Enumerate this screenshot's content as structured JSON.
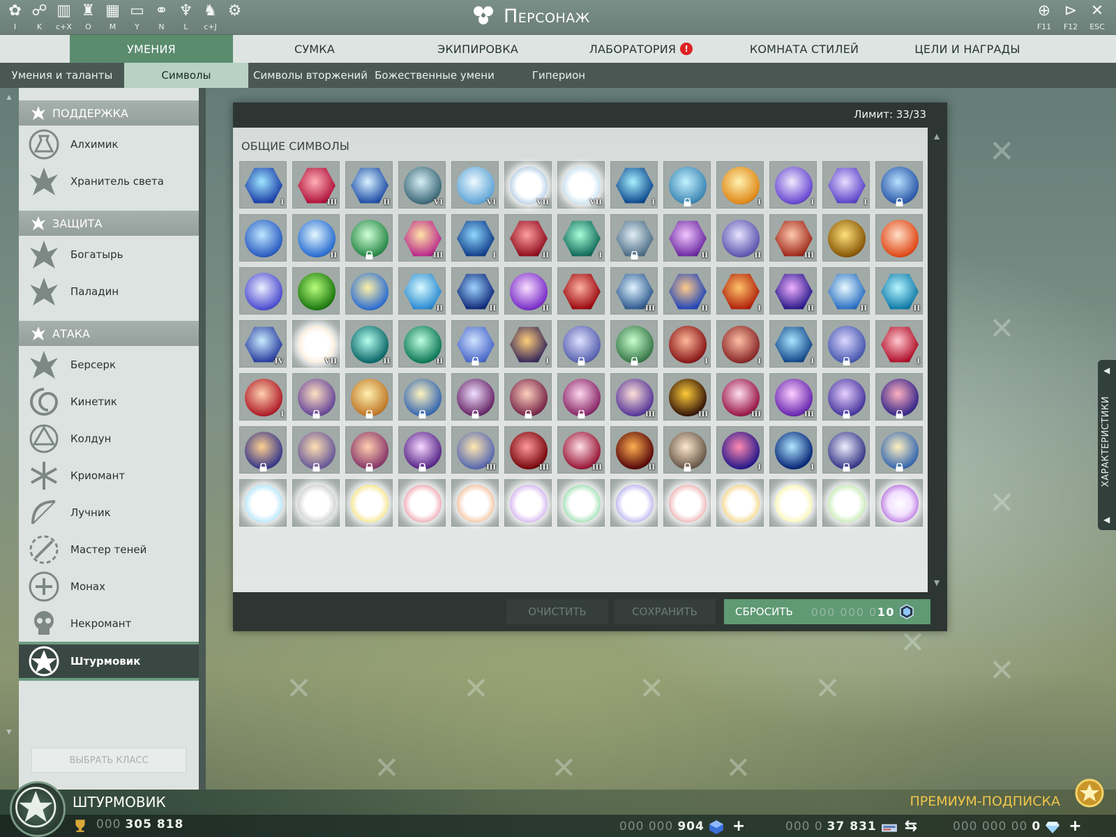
{
  "window": {
    "title": "Персонаж"
  },
  "top_icons": [
    {
      "icon": "character-icon",
      "key": "I"
    },
    {
      "icon": "skills-tree-icon",
      "key": "K"
    },
    {
      "icon": "stats-icon",
      "key": "c+X"
    },
    {
      "icon": "guild-icon",
      "key": "O"
    },
    {
      "icon": "map-icon",
      "key": "M"
    },
    {
      "icon": "chat-icon",
      "key": "Y"
    },
    {
      "icon": "handshake-icon",
      "key": "N"
    },
    {
      "icon": "league-icon",
      "key": "L"
    },
    {
      "icon": "mount-icon",
      "key": "c+J"
    },
    {
      "icon": "settings-icon",
      "key": ""
    }
  ],
  "right_icons": [
    {
      "icon": "network-icon",
      "key": "F11"
    },
    {
      "icon": "exit-door-icon",
      "key": "F12"
    },
    {
      "icon": "close-icon",
      "key": "ESC"
    }
  ],
  "main_tabs": [
    {
      "label": "Умения",
      "active": true,
      "alert": false
    },
    {
      "label": "Сумка",
      "active": false,
      "alert": false
    },
    {
      "label": "Экипировка",
      "active": false,
      "alert": false
    },
    {
      "label": "Лаборатория",
      "active": false,
      "alert": true,
      "alert_text": "!"
    },
    {
      "label": "Комната стилей",
      "active": false,
      "alert": false
    },
    {
      "label": "Цели и награды",
      "active": false,
      "alert": false
    }
  ],
  "sub_tabs": [
    {
      "label": "Умения и таланты",
      "active": false
    },
    {
      "label": "Символы",
      "active": true
    },
    {
      "label": "Символы вторжений",
      "active": false
    },
    {
      "label": "Божественные умени",
      "active": false
    },
    {
      "label": "Гиперион",
      "active": false
    }
  ],
  "sidebar": {
    "groups": [
      {
        "label": "Поддержка",
        "icon": "ankh-icon",
        "classes": [
          {
            "label": "Алхимик",
            "icon": "flask-icon"
          },
          {
            "label": "Хранитель света",
            "icon": "light-wings-icon"
          }
        ]
      },
      {
        "label": "Защита",
        "icon": "shield-icon",
        "classes": [
          {
            "label": "Богатырь",
            "icon": "eagle-icon"
          },
          {
            "label": "Паладин",
            "icon": "sword-wings-icon"
          }
        ]
      },
      {
        "label": "Атака",
        "icon": "dagger-icon",
        "classes": [
          {
            "label": "Берсерк",
            "icon": "berserk-helmet-icon"
          },
          {
            "label": "Кинетик",
            "icon": "spiral-icon"
          },
          {
            "label": "Колдун",
            "icon": "rune-circle-icon"
          },
          {
            "label": "Криомант",
            "icon": "snowflake-icon"
          },
          {
            "label": "Лучник",
            "icon": "bow-icon"
          },
          {
            "label": "Мастер теней",
            "icon": "shadow-blades-icon"
          },
          {
            "label": "Монах",
            "icon": "monk-seal-icon"
          },
          {
            "label": "Некромант",
            "icon": "skull-icon"
          },
          {
            "label": "Штурмовик",
            "icon": "star-badge-icon",
            "active": true
          }
        ]
      }
    ],
    "choose_button": "Выбрать класс"
  },
  "panel": {
    "limit_text": "Лимит: 33/33",
    "grid_title": "Общие символы",
    "buttons": {
      "clear": "Очистить",
      "save": "Сохранить",
      "reset": "Сбросить"
    },
    "reset_cost": {
      "zeros": "000 000 0",
      "value": "10",
      "icon": "crystal-icon"
    },
    "colors": {
      "panel": "#2e3634",
      "reset": "#5f9a74"
    }
  },
  "symbols": [
    {
      "name": "sprint-arrows-icon",
      "rank": "I",
      "locked": false,
      "c1": "#9fe6ff",
      "c2": "#1b3fa8",
      "hex": true
    },
    {
      "name": "red-claw-icon",
      "rank": "III",
      "locked": false,
      "c1": "#ffb0b8",
      "c2": "#b0123a",
      "hex": true
    },
    {
      "name": "crystal-cross-icon",
      "rank": "II",
      "locked": false,
      "c1": "#d9f3ff",
      "c2": "#1f4fa8",
      "hex": true
    },
    {
      "name": "target-ring-icon",
      "rank": "VI",
      "locked": false,
      "c1": "#d8f0f6",
      "c2": "#3f6b7a",
      "hex": false
    },
    {
      "name": "ice-cube-icon",
      "rank": "VI",
      "locked": false,
      "c1": "#eefaff",
      "c2": "#63a7d8",
      "hex": false
    },
    {
      "name": "white-prism-icon",
      "rank": "VII",
      "locked": false,
      "c1": "#ffffff",
      "c2": "#8fb4da",
      "hex": false,
      "faint": true
    },
    {
      "name": "white-shard-icon",
      "rank": "VII",
      "locked": false,
      "c1": "#ffffff",
      "c2": "#a8d2ea",
      "hex": false,
      "faint": true
    },
    {
      "name": "blue-fist-icon",
      "rank": "I",
      "locked": false,
      "c1": "#a7f0ff",
      "c2": "#0e4a8f",
      "hex": true
    },
    {
      "name": "winged-shield-icon",
      "rank": "",
      "locked": true,
      "c1": "#c3f2ff",
      "c2": "#3f88b5",
      "hex": false
    },
    {
      "name": "golden-flare-icon",
      "rank": "I",
      "locked": false,
      "c1": "#fff2b2",
      "c2": "#e08a1a",
      "hex": false
    },
    {
      "name": "lightning-spiral-icon",
      "rank": "I",
      "locked": false,
      "c1": "#f1eaff",
      "c2": "#6a49d1",
      "hex": false
    },
    {
      "name": "lightning-bolt-icon",
      "rank": "I",
      "locked": false,
      "c1": "#eadcff",
      "c2": "#5b45c9",
      "hex": true
    },
    {
      "name": "blue-guardian-icon",
      "rank": "",
      "locked": true,
      "c1": "#b7e0ff",
      "c2": "#2e5aa8",
      "hex": false
    },
    {
      "name": "blue-figure-icon",
      "rank": "",
      "locked": false,
      "c1": "#bfe7ff",
      "c2": "#2c5ec2",
      "hex": false
    },
    {
      "name": "blue-vortex-icon",
      "rank": "II",
      "locked": false,
      "c1": "#e7f8ff",
      "c2": "#2a6fd1",
      "hex": false
    },
    {
      "name": "green-antlers-icon",
      "rank": "",
      "locked": true,
      "c1": "#d1ffd8",
      "c2": "#2b8a4a",
      "hex": false
    },
    {
      "name": "fire-fist-icon",
      "rank": "III",
      "locked": false,
      "c1": "#ffe4a6",
      "c2": "#b82b8a",
      "hex": true
    },
    {
      "name": "blue-runner-icon",
      "rank": "I",
      "locked": false,
      "c1": "#8fd8ff",
      "c2": "#123f8a",
      "hex": true
    },
    {
      "name": "red-runner-icon",
      "rank": "II",
      "locked": false,
      "c1": "#ff9fa0",
      "c2": "#8f1020",
      "hex": true
    },
    {
      "name": "green-runner-icon",
      "rank": "I",
      "locked": false,
      "c1": "#a8ffd9",
      "c2": "#126a5a",
      "hex": true
    },
    {
      "name": "steel-swirl-icon",
      "rank": "",
      "locked": true,
      "c1": "#e1eef6",
      "c2": "#4e6e86",
      "hex": true
    },
    {
      "name": "purple-dancer-icon",
      "rank": "II",
      "locked": false,
      "c1": "#f1c8ff",
      "c2": "#6d2aa1",
      "hex": true
    },
    {
      "name": "armored-titan-icon",
      "rank": "II",
      "locked": false,
      "c1": "#e8e4ff",
      "c2": "#5f57b0",
      "hex": false
    },
    {
      "name": "red-skull-icon",
      "rank": "III",
      "locked": false,
      "c1": "#ffc9b0",
      "c2": "#9f2a1a",
      "hex": true
    },
    {
      "name": "gold-fist-icon",
      "rank": "",
      "locked": false,
      "c1": "#ffe17a",
      "c2": "#8a5a0a",
      "hex": false
    },
    {
      "name": "ember-figure-icon",
      "rank": "",
      "locked": false,
      "c1": "#ffe1c9",
      "c2": "#e04a1a",
      "hex": false
    },
    {
      "name": "purple-spirit-icon",
      "rank": "",
      "locked": false,
      "c1": "#eef0ff",
      "c2": "#4f4fd1",
      "hex": false
    },
    {
      "name": "green-fist-icon",
      "rank": "",
      "locked": false,
      "c1": "#b7ff7d",
      "c2": "#1f7a10",
      "hex": false
    },
    {
      "name": "sun-dragon-icon",
      "rank": "",
      "locked": false,
      "c1": "#fff1a6",
      "c2": "#2f6fd1",
      "hex": false
    },
    {
      "name": "ice-arrow-icon",
      "rank": "II",
      "locked": false,
      "c1": "#d9fbff",
      "c2": "#2a8ad1",
      "hex": true
    },
    {
      "name": "blue-boot-icon",
      "rank": "II",
      "locked": false,
      "c1": "#9fd3ff",
      "c2": "#102a7a",
      "hex": true
    },
    {
      "name": "violet-aura-icon",
      "rank": "II",
      "locked": false,
      "c1": "#fbe0ff",
      "c2": "#7a30c9",
      "hex": false
    },
    {
      "name": "red-burst-icon",
      "rank": "",
      "locked": false,
      "c1": "#ffb0a0",
      "c2": "#9a0a10",
      "hex": true
    },
    {
      "name": "ghost-skull-icon",
      "rank": "III",
      "locked": false,
      "c1": "#dff4ff",
      "c2": "#2f5a8f",
      "hex": true
    },
    {
      "name": "fire-comet-icon",
      "rank": "II",
      "locked": false,
      "c1": "#ffca8a",
      "c2": "#2346b8",
      "hex": true
    },
    {
      "name": "lava-wave-icon",
      "rank": "I",
      "locked": false,
      "c1": "#ffc46a",
      "c2": "#b0220a",
      "hex": true
    },
    {
      "name": "meditation-icon",
      "rank": "II",
      "locked": false,
      "c1": "#f0b0ff",
      "c2": "#2a1a8a",
      "hex": true
    },
    {
      "name": "ice-beam-icon",
      "rank": "II",
      "locked": false,
      "c1": "#e9fbff",
      "c2": "#2b6fc2",
      "hex": true
    },
    {
      "name": "ice-shards-icon",
      "rank": "II",
      "locked": false,
      "c1": "#b7f6ff",
      "c2": "#0f7aa8",
      "hex": true
    },
    {
      "name": "frost-armor-icon",
      "rank": "IV",
      "locked": false,
      "c1": "#c9ecff",
      "c2": "#2b3f9f",
      "hex": true
    },
    {
      "name": "white-nova-icon",
      "rank": "VII",
      "locked": false,
      "c1": "#ffffff",
      "c2": "#f4dfbf",
      "hex": false,
      "faint": true
    },
    {
      "name": "teal-spire-icon",
      "rank": "II",
      "locked": false,
      "c1": "#b5fff0",
      "c2": "#0f6a6a",
      "hex": false
    },
    {
      "name": "green-crown-icon",
      "rank": "II",
      "locked": false,
      "c1": "#c0ffe0",
      "c2": "#0f7a5a",
      "hex": false
    },
    {
      "name": "storm-hex-icon",
      "rank": "",
      "locked": true,
      "c1": "#cfe3ff",
      "c2": "#4a68c9",
      "hex": true
    },
    {
      "name": "honeycomb-icon",
      "rank": "I",
      "locked": false,
      "c1": "#ffcf7a",
      "c2": "#3a2a5a",
      "hex": true
    },
    {
      "name": "moon-arc-icon",
      "rank": "",
      "locked": true,
      "c1": "#dfe2ff",
      "c2": "#5a63b0",
      "hex": false
    },
    {
      "name": "leaping-warrior-icon",
      "rank": "",
      "locked": true,
      "c1": "#c8ffd0",
      "c2": "#3a7a4a",
      "hex": false
    },
    {
      "name": "blood-blade-icon",
      "rank": "I",
      "locked": false,
      "c1": "#ffb89a",
      "c2": "#8a1a1a",
      "hex": false
    },
    {
      "name": "winged-demon-icon",
      "rank": "I",
      "locked": false,
      "c1": "#ffc0a6",
      "c2": "#8a2a2a",
      "hex": false
    },
    {
      "name": "blue-sentinel-icon",
      "rank": "I",
      "locked": false,
      "c1": "#a9e5ff",
      "c2": "#14498a",
      "hex": true
    },
    {
      "name": "void-orb-icon",
      "rank": "",
      "locked": true,
      "c1": "#dcd8ff",
      "c2": "#4a5ab0",
      "hex": false
    },
    {
      "name": "crimson-core-icon",
      "rank": "I",
      "locked": false,
      "c1": "#ffc8d0",
      "c2": "#b0102a",
      "hex": true
    },
    {
      "name": "flame-crest-icon",
      "rank": "I",
      "locked": false,
      "c1": "#ffd0b0",
      "c2": "#b0202a",
      "hex": false
    },
    {
      "name": "golden-hero-icon",
      "rank": "",
      "locked": true,
      "c1": "#ffe0c0",
      "c2": "#6a4a9a",
      "hex": false
    },
    {
      "name": "sun-warrior-icon",
      "rank": "",
      "locked": true,
      "c1": "#fff0b0",
      "c2": "#c07a2a",
      "hex": false
    },
    {
      "name": "phoenix-wings-icon",
      "rank": "",
      "locked": true,
      "c1": "#fff3c0",
      "c2": "#3a6ab0",
      "hex": false
    },
    {
      "name": "dark-knight-icon",
      "rank": "",
      "locked": true,
      "c1": "#f0e0ff",
      "c2": "#6a2a6a",
      "hex": false
    },
    {
      "name": "crimson-burst-icon",
      "rank": "",
      "locked": true,
      "c1": "#ffd0c0",
      "c2": "#7a2a4a",
      "hex": false
    },
    {
      "name": "pink-spiral-icon",
      "rank": "",
      "locked": true,
      "c1": "#ffd8f0",
      "c2": "#8a2a6a",
      "hex": false
    },
    {
      "name": "plasma-flash-icon",
      "rank": "III",
      "locked": false,
      "c1": "#ffe0d8",
      "c2": "#5a3a9a",
      "hex": false
    },
    {
      "name": "golden-storm-icon",
      "rank": "III",
      "locked": false,
      "c1": "#ffcc3a",
      "c2": "#3a1a0a",
      "hex": false
    },
    {
      "name": "radiant-burst-icon",
      "rank": "III",
      "locked": false,
      "c1": "#ffe0f0",
      "c2": "#9a1a4a",
      "hex": false
    },
    {
      "name": "magenta-slash-icon",
      "rank": "III",
      "locked": false,
      "c1": "#ffd0ff",
      "c2": "#6a2ab0",
      "hex": false
    },
    {
      "name": "violet-wave-icon",
      "rank": "",
      "locked": true,
      "c1": "#e8d0ff",
      "c2": "#4a3aa0",
      "hex": false
    },
    {
      "name": "claw-strike-icon",
      "rank": "",
      "locked": true,
      "c1": "#ffb0c0",
      "c2": "#3a2a8a",
      "hex": false
    },
    {
      "name": "fire-vortex-icon",
      "rank": "",
      "locked": true,
      "c1": "#ffd090",
      "c2": "#3a3a8a",
      "hex": false
    },
    {
      "name": "eagle-guardian-icon",
      "rank": "",
      "locked": true,
      "c1": "#ffe0b0",
      "c2": "#6a5a9a",
      "hex": false
    },
    {
      "name": "light-pillar-icon",
      "rank": "",
      "locked": true,
      "c1": "#ffd0b0",
      "c2": "#8a3a6a",
      "hex": false
    },
    {
      "name": "violet-caster-icon",
      "rank": "",
      "locked": true,
      "c1": "#f8d8ff",
      "c2": "#5a2a8a",
      "hex": false
    },
    {
      "name": "lightning-dash-icon",
      "rank": "III",
      "locked": false,
      "c1": "#ffe8b0",
      "c2": "#5a6ab0",
      "hex": false
    },
    {
      "name": "zombie-head-icon",
      "rank": "III",
      "locked": false,
      "c1": "#ff9a9a",
      "c2": "#7a0a10",
      "hex": false
    },
    {
      "name": "rose-flare-icon",
      "rank": "III",
      "locked": false,
      "c1": "#ffe0e8",
      "c2": "#9a1a3a",
      "hex": false
    },
    {
      "name": "fire-trio-icon",
      "rank": "II",
      "locked": false,
      "c1": "#ffb050",
      "c2": "#5a0a0a",
      "hex": false
    },
    {
      "name": "monk-master-icon",
      "rank": "",
      "locked": true,
      "c1": "#ffe8d0",
      "c2": "#6a5a4a",
      "hex": false
    },
    {
      "name": "red-avatar-icon",
      "rank": "I",
      "locked": false,
      "c1": "#ff8ab0",
      "c2": "#2a1a8a",
      "hex": false
    },
    {
      "name": "blue-eclipse-icon",
      "rank": "I",
      "locked": false,
      "c1": "#b0e8ff",
      "c2": "#0a2a7a",
      "hex": false
    },
    {
      "name": "star-flash-icon",
      "rank": "",
      "locked": true,
      "c1": "#f0f0ff",
      "c2": "#3a3a8a",
      "hex": false
    },
    {
      "name": "ancient-scroll-icon",
      "rank": "",
      "locked": true,
      "c1": "#fff0c0",
      "c2": "#3a6ab0",
      "hex": false
    },
    {
      "name": "snowflake-symbol-icon",
      "rank": "",
      "locked": false,
      "c1": "#ffffff",
      "c2": "#8ad8ff",
      "hex": false,
      "faint": true
    },
    {
      "name": "winged-sword-icon",
      "rank": "",
      "locked": false,
      "c1": "#ffffff",
      "c2": "#b8b8b8",
      "hex": false,
      "faint": true
    },
    {
      "name": "golden-wings-icon",
      "rank": "",
      "locked": false,
      "c1": "#ffffff",
      "c2": "#f2d84a",
      "hex": false,
      "faint": true
    },
    {
      "name": "heart-wings-icon",
      "rank": "",
      "locked": false,
      "c1": "#ffffff",
      "c2": "#e87a8a",
      "hex": false,
      "faint": true
    },
    {
      "name": "flame-crown-icon",
      "rank": "",
      "locked": false,
      "c1": "#ffffff",
      "c2": "#f0a36a",
      "hex": false,
      "faint": true
    },
    {
      "name": "violet-ring-icon",
      "rank": "",
      "locked": false,
      "c1": "#ffffff",
      "c2": "#c08ae8",
      "hex": false,
      "faint": true
    },
    {
      "name": "green-skull-icon",
      "rank": "",
      "locked": false,
      "c1": "#ffffff",
      "c2": "#6ad08a",
      "hex": false,
      "faint": true
    },
    {
      "name": "purple-swirl-icon",
      "rank": "",
      "locked": false,
      "c1": "#ffffff",
      "c2": "#9a8ae8",
      "hex": false,
      "faint": true
    },
    {
      "name": "crimson-ring-icon",
      "rank": "",
      "locked": false,
      "c1": "#ffffff",
      "c2": "#e88a8a",
      "hex": false,
      "faint": true
    },
    {
      "name": "golden-phoenix-icon",
      "rank": "",
      "locked": false,
      "c1": "#ffffff",
      "c2": "#f2c24a",
      "hex": false,
      "faint": true
    },
    {
      "name": "sun-disc-icon",
      "rank": "",
      "locked": false,
      "c1": "#ffffff",
      "c2": "#f5f08a",
      "hex": false,
      "faint": true
    },
    {
      "name": "green-pyramid-icon",
      "rank": "",
      "locked": false,
      "c1": "#ffffff",
      "c2": "#a8e08a",
      "hex": false,
      "faint": true
    },
    {
      "name": "violet-triangle-icon",
      "rank": "",
      "locked": false,
      "c1": "#f2e0ff",
      "c2": "#a04ad0",
      "hex": false,
      "faint": true
    }
  ],
  "side_tab": {
    "label": "Характеристики"
  },
  "bottom": {
    "class_name": "Штурмовик",
    "premium": "Премиум-подписка",
    "currencies": [
      {
        "zeros": "000",
        "value": "305 818",
        "icon": "honor-trophy-icon",
        "plus": false
      },
      {
        "zeros": "000 000",
        "value": "904",
        "icon": "blue-cube-icon",
        "plus": true
      },
      {
        "zeros": "000 0",
        "value": "37 831",
        "icon": "gold-bars-icon",
        "plus": false,
        "exchange": true
      },
      {
        "zeros": "000 000 00",
        "value": "0",
        "icon": "diamond-icon",
        "plus": true
      }
    ]
  }
}
